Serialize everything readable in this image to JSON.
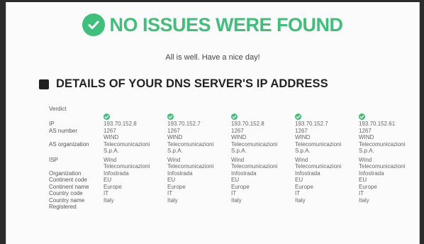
{
  "hero": {
    "title": "NO ISSUES WERE FOUND",
    "subtitle": "All is well. Have a nice day!",
    "accent_color": "#3ec07a",
    "icon": "check-circle-icon"
  },
  "section": {
    "title": "DETAILS OF YOUR DNS SERVER'S IP ADDRESS",
    "icon": "square-icon"
  },
  "details": {
    "labels": {
      "verdict": "Verdict",
      "ip": "IP",
      "as_number": "AS number",
      "as_org": "AS organization",
      "isp": "ISP",
      "organization": "Organization",
      "continent_code": "Continent code",
      "continent_name": "Continent name",
      "country_code": "Country code",
      "country_name": "Country name",
      "registered": "Registered"
    },
    "servers": [
      {
        "ip": "193.70.152.8",
        "as_number": "1267",
        "as_org_1": "WIND",
        "as_org_2": "Telecomunicazioni",
        "as_org_3": "S.p.A.",
        "isp_1": "Wind",
        "isp_2": "Telecomunicazioni",
        "organization": "Infostrada",
        "continent_code": "EU",
        "continent_name": "Europe",
        "country_code": "IT",
        "country_name": "Italy"
      },
      {
        "ip": "193.70.152.7",
        "as_number": "1267",
        "as_org_1": "WIND",
        "as_org_2": "Telecomunicazioni",
        "as_org_3": "S.p.A.",
        "isp_1": "Wind",
        "isp_2": "Telecomunicazioni",
        "organization": "Infostrada",
        "continent_code": "EU",
        "continent_name": "Europe",
        "country_code": "IT",
        "country_name": "Italy"
      },
      {
        "ip": "193.70.152.8",
        "as_number": "1267",
        "as_org_1": "WIND",
        "as_org_2": "Telecomunicazioni",
        "as_org_3": "S.p.A.",
        "isp_1": "Wind",
        "isp_2": "Telecomunicazioni",
        "organization": "Infostrada",
        "continent_code": "EU",
        "continent_name": "Europe",
        "country_code": "IT",
        "country_name": "Italy"
      },
      {
        "ip": "193.70.152.7",
        "as_number": "1267",
        "as_org_1": "WIND",
        "as_org_2": "Telecomunicazioni",
        "as_org_3": "S.p.A.",
        "isp_1": "Wind",
        "isp_2": "Telecomunicazioni",
        "organization": "Infostrada",
        "continent_code": "EU",
        "continent_name": "Europe",
        "country_code": "IT",
        "country_name": "Italy"
      },
      {
        "ip": "193.70.152.61",
        "as_number": "1267",
        "as_org_1": "WIND",
        "as_org_2": "Telecomunicazioni",
        "as_org_3": "S.p.A.",
        "isp_1": "Wind",
        "isp_2": "Telecomunicazioni",
        "organization": "Infostrada",
        "continent_code": "EU",
        "continent_name": "Europe",
        "country_code": "IT",
        "country_name": "Italy"
      }
    ]
  }
}
